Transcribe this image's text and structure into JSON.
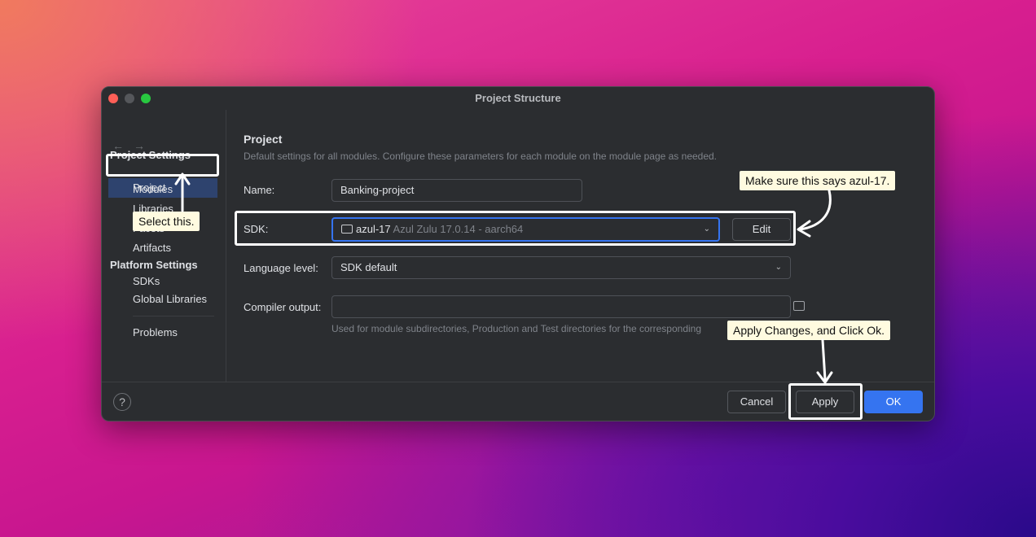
{
  "window": {
    "title": "Project Structure"
  },
  "sidebar": {
    "nav_back": "←",
    "nav_forward": "→",
    "project_settings_heading": "Project Settings",
    "project_settings_items": [
      "Project",
      "Modules",
      "Libraries",
      "Facets",
      "Artifacts"
    ],
    "platform_settings_heading": "Platform Settings",
    "platform_settings_items": [
      "SDKs",
      "Global Libraries"
    ],
    "problems": "Problems",
    "selected": "Project"
  },
  "main": {
    "heading": "Project",
    "description": "Default settings for all modules. Configure these parameters for each module on the module page as needed.",
    "name_label": "Name:",
    "name_value": "Banking-project",
    "sdk_label": "SDK:",
    "sdk_value": "azul-17",
    "sdk_detail": "Azul Zulu 17.0.14 - aarch64",
    "edit_button": "Edit",
    "language_level_label": "Language level:",
    "language_level_value": "SDK default",
    "compiler_output_label": "Compiler output:",
    "compiler_output_value": "",
    "compiler_output_hint": "Used for module subdirectories, Production and Test directories for the corresponding"
  },
  "footer": {
    "help": "?",
    "cancel": "Cancel",
    "apply": "Apply",
    "ok": "OK"
  },
  "annotations": {
    "select_this": "Select this.",
    "sdk_note": "Make sure this says azul-17.",
    "apply_note": "Apply Changes, and Click Ok."
  },
  "colors": {
    "accent": "#3574f0",
    "selection": "#2e436e",
    "callout_bg": "#fffbe0",
    "highlight": "#ffffff"
  }
}
